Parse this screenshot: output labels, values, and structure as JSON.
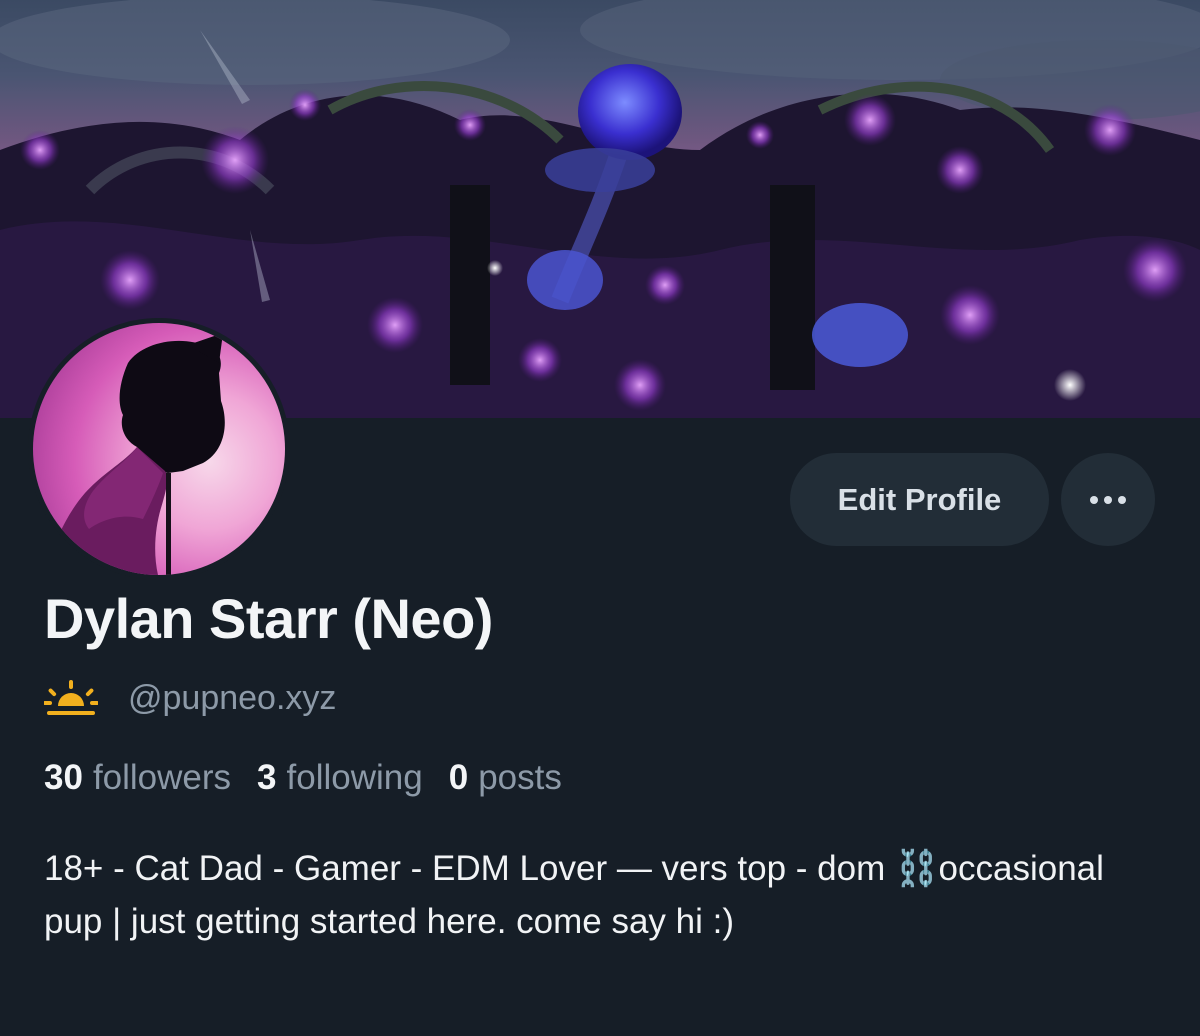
{
  "profile": {
    "display_name": "Dylan Starr (Neo)",
    "handle": "@pupneo.xyz",
    "handle_icon": "sun-icon",
    "bio": "18+ - Cat Dad - Gamer - EDM Lover — vers top - dom ⛓️occasional pup | just getting started here. come say hi :)",
    "banner_description": "",
    "avatar_icon": "avatar-silhouette"
  },
  "stats": {
    "followers_count": "30",
    "followers_label": "followers",
    "following_count": "3",
    "following_label": "following",
    "posts_count": "0",
    "posts_label": "posts"
  },
  "actions": {
    "edit_profile_label": "Edit Profile",
    "more_icon": "ellipsis-icon"
  },
  "colors": {
    "background": "#161e27",
    "button_bg": "#222d37",
    "secondary_text": "#8d9aa8",
    "sun_icon": "#f2b01e"
  }
}
